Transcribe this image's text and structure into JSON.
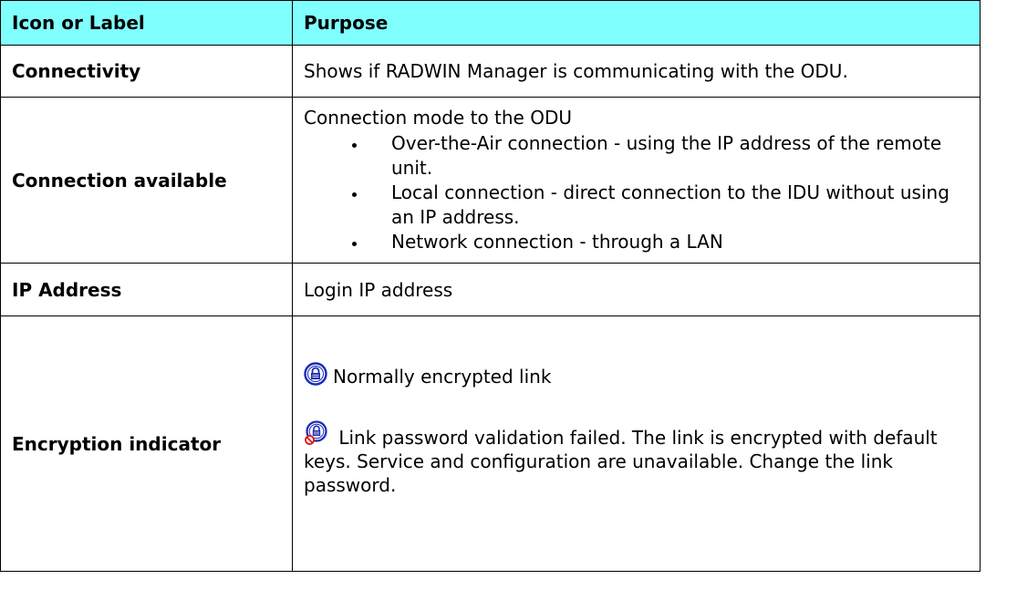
{
  "table": {
    "header": {
      "col1": "Icon or Label",
      "col2": "Purpose"
    },
    "rows": [
      {
        "label": "Connectivity",
        "purpose": "Shows if RADWIN Manager is communicating with the ODU."
      },
      {
        "label": "Connection available",
        "intro": "Connection mode to the ODU",
        "bullets": [
          "Over-the-Air connection - using the IP address of the remote unit.",
          "Local connection - direct connection to the IDU without using an IP address.",
          "Network connection - through a LAN"
        ]
      },
      {
        "label": "IP Address",
        "purpose": "Login IP address"
      },
      {
        "label": "Encryption indicator",
        "items": [
          {
            "icon": "encrypted-lock-icon",
            "text": "Normally encrypted link"
          },
          {
            "icon": "encryption-failed-lock-icon",
            "text": "Link password validation failed. The link is encrypted with default keys. Service and configuration are unavailable. Change the link password."
          }
        ]
      }
    ]
  },
  "colors": {
    "header_bg": "#80ffff",
    "lock_blue": "#1a2bb5",
    "fail_red": "#e01818"
  }
}
